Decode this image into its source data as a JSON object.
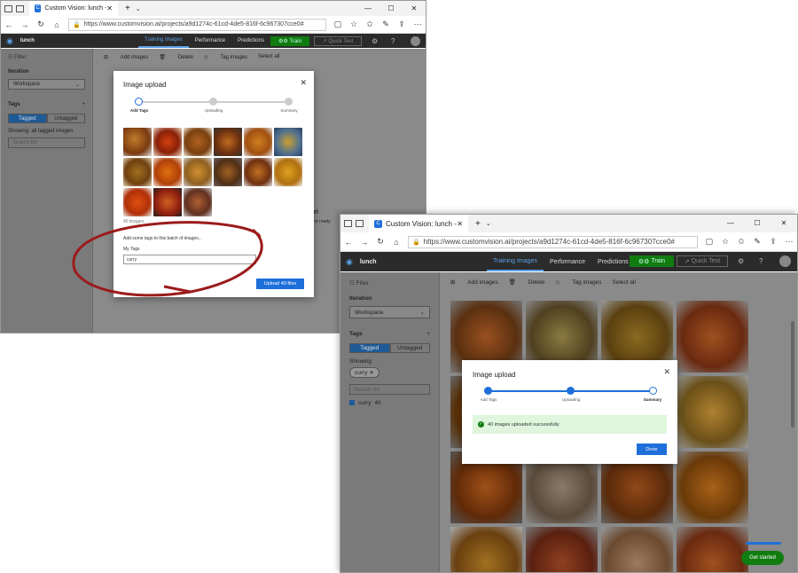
{
  "browser": {
    "tab_title": "Custom Vision: lunch - ",
    "url": "https://www.customvision.ai/projects/a9d1274c-61cd-4de5-816f-6c967307cce0#"
  },
  "app": {
    "project": "lunch",
    "tabs": [
      "Training Images",
      "Performance",
      "Predictions"
    ],
    "train_label": "Train",
    "quick_test_label": "Quick Test"
  },
  "sidebar": {
    "filter": "Filter",
    "iteration_heading": "Iteration",
    "iteration_value": "Workspace",
    "tags_heading": "Tags",
    "tagged": "Tagged",
    "untagged": "Untagged",
    "showing_all": "Showing: all tagged images",
    "showing": "Showing",
    "chip": "curry",
    "search_placeholder": "Search for",
    "tag_item": "curry",
    "tag_count": "40"
  },
  "toolbar": {
    "add_images": "Add images",
    "delete": "Delete",
    "tag_images": "Tag images",
    "select_all": "Select all"
  },
  "modal1": {
    "title": "Image upload",
    "steps": [
      "Add Tags",
      "Uploading",
      "Summary"
    ],
    "count": "40 images",
    "add_tags_prompt": "Add some tags to this batch of images...",
    "my_tags": "My Tags",
    "tag_value": "curry",
    "upload_button": "Upload 40 files"
  },
  "modal2": {
    "title": "Image upload",
    "steps": [
      "Add Tags",
      "Uploading",
      "Summary"
    ],
    "success": "40 images uploaded successfully",
    "done_button": "Done"
  },
  "background_text": {
    "more": "ore!",
    "sub": "be for ready"
  },
  "get_started": "Get started",
  "colors": {
    "accent": "#1e6fd9",
    "train_green": "#107c10",
    "annotation_red": "#9b1b1b"
  }
}
